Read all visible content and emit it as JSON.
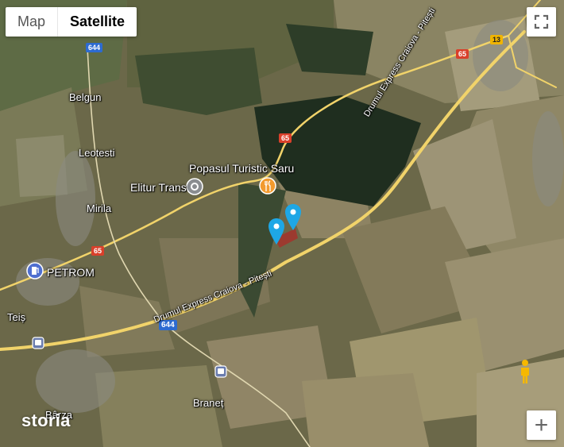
{
  "map_type": {
    "map_label": "Map",
    "satellite_label": "Satellite",
    "selected": "Satellite"
  },
  "places": {
    "belgun": "Belgun",
    "leotesti": "Leotesti",
    "mirila": "Mirila",
    "elitur": "Elitur Trans",
    "popasul": "Popasul Turistic Saru",
    "petrom": "PETROM",
    "teis": "Teiș",
    "branet": "Braneț",
    "barza": "Bârza"
  },
  "roads": {
    "r644_top": "644",
    "r644_bottom": "644",
    "r65_top": "65",
    "r65_mid": "65",
    "r65_left": "65",
    "r13": "13",
    "express_top": "Drumul Express Craiova - Pitești",
    "express_bottom": "Drumul Express Craiova - Pitești"
  },
  "watermark": "storia",
  "colors": {
    "shield_blue": "#2d6bd1",
    "shield_red": "#d9402b",
    "pin_blue": "#1ea7e6",
    "poi_orange": "#f29a2e",
    "road": "#f1d36a"
  }
}
